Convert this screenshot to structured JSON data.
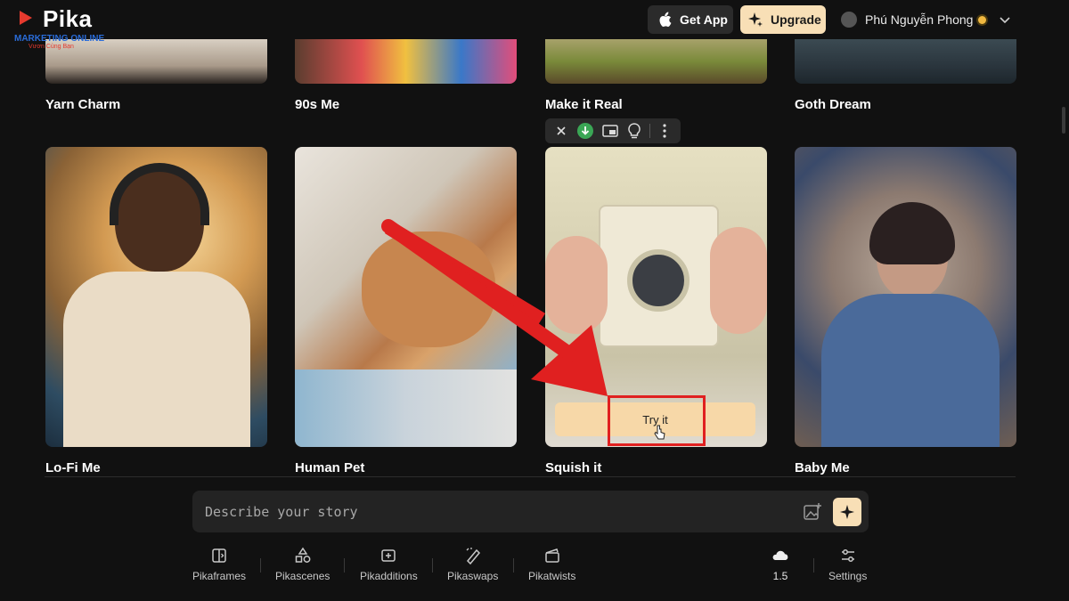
{
  "header": {
    "logo_text": "Pika",
    "watermark_line1": "MARKETING ONLINE",
    "watermark_line2": "Vươn Cùng Bạn",
    "get_app_label": "Get App",
    "upgrade_label": "Upgrade",
    "user_name": "Phú Nguyễn Phong"
  },
  "gallery": {
    "top_row": [
      {
        "label": "Yarn Charm"
      },
      {
        "label": "90s Me"
      },
      {
        "label": "Make it Real"
      },
      {
        "label": "Goth Dream"
      }
    ],
    "main_row": [
      {
        "label": "Lo-Fi Me"
      },
      {
        "label": "Human Pet"
      },
      {
        "label": "Squish it"
      },
      {
        "label": "Baby Me"
      }
    ],
    "try_label": "Try it"
  },
  "tile_toolbar": {
    "icons": [
      "close-icon",
      "download-icon",
      "save-icon",
      "idea-icon",
      "more-icon"
    ]
  },
  "prompt": {
    "placeholder": "Describe your story"
  },
  "tools": {
    "items": [
      {
        "label": "Pikaframes",
        "icon": "frames-icon"
      },
      {
        "label": "Pikascenes",
        "icon": "scenes-icon"
      },
      {
        "label": "Pikadditions",
        "icon": "additions-icon"
      },
      {
        "label": "Pikaswaps",
        "icon": "swaps-icon"
      },
      {
        "label": "Pikatwists",
        "icon": "twists-icon"
      }
    ],
    "model_version": "1.5",
    "settings_label": "Settings"
  },
  "colors": {
    "background": "#111111",
    "accent": "#f8dfb6",
    "annotation": "#e02020"
  }
}
